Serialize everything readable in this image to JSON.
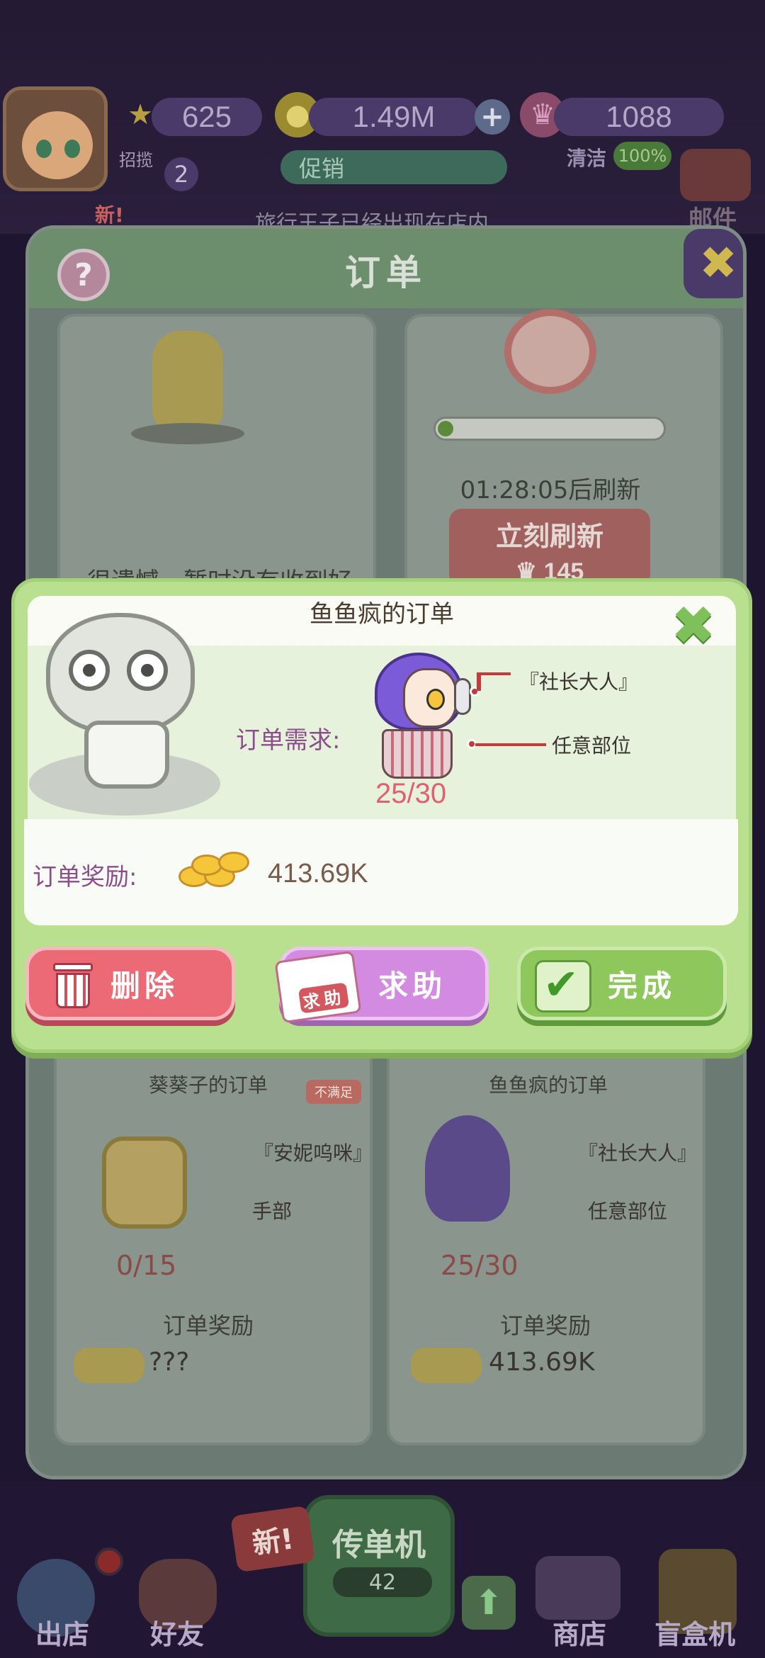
{
  "hud": {
    "stars": "625",
    "coins": "1.49M",
    "crowns": "1088",
    "promo": "促销",
    "clean_label": "清洁",
    "clean_value": "100%",
    "invite_label": "招揽",
    "invite_count": "2",
    "new_badge": "新!",
    "ticker": "旅行王子已经出现在店内",
    "mail": "邮件"
  },
  "panel": {
    "title": "订单",
    "help": "?",
    "close": "✖",
    "friend_card_text": "很遗憾，暂时没有收到好友发出的求助订单",
    "timer_text": "01:28:05后刷新",
    "refresh_label": "立刻刷新",
    "refresh_cost": "145",
    "refresh_progress": 0.05
  },
  "modal": {
    "title": "鱼鱼疯的订单",
    "close": "✖",
    "need_label": "订单需求:",
    "item_name": "『社长大人』",
    "item_part": "任意部位",
    "progress": "25/30",
    "reward_label": "订单奖励:",
    "reward_value": "413.69K",
    "buttons": {
      "delete": "删除",
      "help": "求助",
      "help_tag": "求助",
      "done": "完成"
    }
  },
  "cards": [
    {
      "title": "葵葵子的订单",
      "badge": "不满足",
      "item_name": "『安妮呜咪』",
      "item_part": "手部",
      "progress": "0/15",
      "reward_label": "订单奖励",
      "reward_value": "???"
    },
    {
      "title": "鱼鱼疯的订单",
      "item_name": "『社长大人』",
      "item_part": "任意部位",
      "progress": "25/30",
      "reward_label": "订单奖励",
      "reward_value": "413.69K"
    }
  ],
  "nav": {
    "shop_out": "出店",
    "friends": "好友",
    "flyer": "传单机",
    "flyer_count": "42",
    "new_badge": "新!",
    "store": "商店",
    "blindbox": "盲盒机"
  },
  "colors": {
    "modal_bg": "#b9e08f",
    "delete": "#ec6a76",
    "help": "#d28be0",
    "done": "#8ec85c",
    "progress_red": "#e06072"
  }
}
